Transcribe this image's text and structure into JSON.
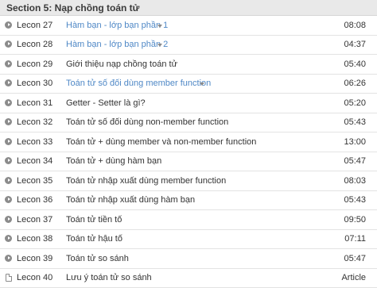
{
  "section": {
    "title": "Section 5: Nạp chồng toán tử"
  },
  "lessons": [
    {
      "number": "Lecon 27",
      "title": "Hàm bạn - lớp bạn phần 1",
      "duration": "08:08",
      "icon": "play-icon",
      "expandable": true
    },
    {
      "number": "Lecon 28",
      "title": "Hàm bạn - lớp bạn phần 2",
      "duration": "04:37",
      "icon": "play-icon",
      "expandable": true
    },
    {
      "number": "Lecon 29",
      "title": "Giới thiệu nạp chồng toán tử",
      "duration": "05:40",
      "icon": "play-icon",
      "expandable": false
    },
    {
      "number": "Lecon 30",
      "title": "Toán tử số đối dùng member function",
      "duration": "06:26",
      "icon": "play-icon",
      "expandable": true
    },
    {
      "number": "Lecon 31",
      "title": "Getter - Setter là gì?",
      "duration": "05:20",
      "icon": "play-icon",
      "expandable": false
    },
    {
      "number": "Lecon 32",
      "title": "Toán tử số đối dùng non-member function",
      "duration": "05:43",
      "icon": "play-icon",
      "expandable": false
    },
    {
      "number": "Lecon 33",
      "title": "Toán tử + dùng member và non-member function",
      "duration": "13:00",
      "icon": "play-icon",
      "expandable": false
    },
    {
      "number": "Lecon 34",
      "title": "Toán tử + dùng hàm bạn",
      "duration": "05:47",
      "icon": "play-icon",
      "expandable": false
    },
    {
      "number": "Lecon 35",
      "title": "Toán tử nhập xuất dùng member function",
      "duration": "08:03",
      "icon": "play-icon",
      "expandable": false
    },
    {
      "number": "Lecon 36",
      "title": "Toán tử nhập xuất dùng hàm bạn",
      "duration": "05:43",
      "icon": "play-icon",
      "expandable": false
    },
    {
      "number": "Lecon 37",
      "title": "Toán tử tiền tố",
      "duration": "09:50",
      "icon": "play-icon",
      "expandable": false
    },
    {
      "number": "Lecon 38",
      "title": "Toán tử hậu tố",
      "duration": "07:11",
      "icon": "play-icon",
      "expandable": false
    },
    {
      "number": "Lecon 39",
      "title": "Toán tử so sánh",
      "duration": "05:47",
      "icon": "play-icon",
      "expandable": false
    },
    {
      "number": "Lecon 40",
      "title": "Lưu ý toán tử so sánh",
      "duration": "Article",
      "icon": "document-icon",
      "expandable": false
    }
  ],
  "colors": {
    "link": "#4f88c6",
    "text": "#333333",
    "header_bg": "#e9e9e9",
    "icon": "#8b8b8b"
  }
}
